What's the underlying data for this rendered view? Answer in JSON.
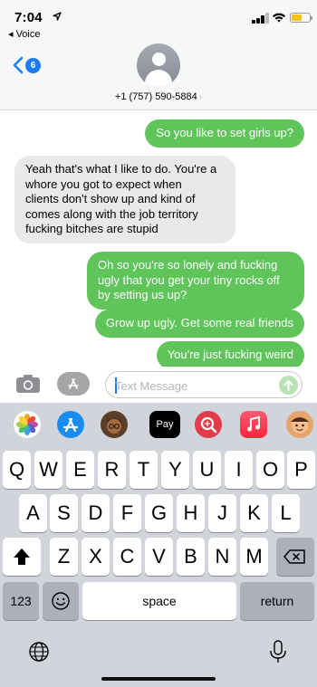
{
  "status": {
    "time": "7:04",
    "back_app": "◂ Voice"
  },
  "header": {
    "badge_count": "6",
    "contact_number": "+1 (757) 590-5884",
    "chevron": "›"
  },
  "messages": [
    {
      "side": "out",
      "lines": [
        "So you like to set girls up?"
      ]
    },
    {
      "side": "in",
      "lines": [
        "Yeah that's what I like to do. You're a",
        "whore you got to expect when",
        "clients don't show up and kind of",
        "comes along with the job territory",
        "fucking bitches are stupid"
      ]
    },
    {
      "side": "out",
      "lines": [
        "Oh so you're so lonely and fucking",
        "ugly that you get your tiny rocks off",
        "by setting us up?"
      ]
    },
    {
      "side": "out",
      "lines": [
        "Grow up ugly. Get some real friends"
      ]
    },
    {
      "side": "out",
      "lines": [
        "You're just fucking weird"
      ]
    }
  ],
  "compose": {
    "placeholder": "Text Message"
  },
  "app_strip": {
    "apple_pay_label": "Pay"
  },
  "keyboard": {
    "row1": [
      "Q",
      "W",
      "E",
      "R",
      "T",
      "Y",
      "U",
      "I",
      "O",
      "P"
    ],
    "row2": [
      "A",
      "S",
      "D",
      "F",
      "G",
      "H",
      "J",
      "K",
      "L"
    ],
    "row3": [
      "Z",
      "X",
      "C",
      "V",
      "B",
      "N",
      "M"
    ],
    "numbers_label": "123",
    "space_label": "space",
    "return_label": "return"
  },
  "colors": {
    "outgoing_bubble": "#5fc55b",
    "incoming_bubble": "#e9e9eb",
    "accent": "#1a7cf5"
  }
}
